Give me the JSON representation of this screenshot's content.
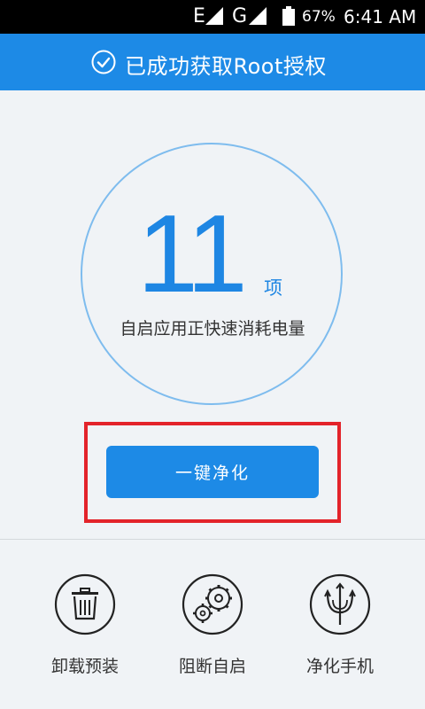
{
  "status_bar": {
    "network_1": "E",
    "network_2": "G",
    "battery_percent": "67%",
    "time": "6:41 AM"
  },
  "header": {
    "title": "已成功获取Root授权",
    "icon": "check-circle-icon"
  },
  "summary": {
    "count": "11",
    "unit": "项",
    "description": "自启应用正快速消耗电量"
  },
  "action_button": {
    "label": "一键净化"
  },
  "tools": [
    {
      "label": "卸载预装",
      "icon": "trash-icon"
    },
    {
      "label": "阻断自启",
      "icon": "gears-icon"
    },
    {
      "label": "净化手机",
      "icon": "trident-icon"
    }
  ],
  "colors": {
    "accent": "#1d8ae6",
    "highlight": "#e3232a",
    "circle": "#7ebcee",
    "background": "#f0f3f6"
  }
}
